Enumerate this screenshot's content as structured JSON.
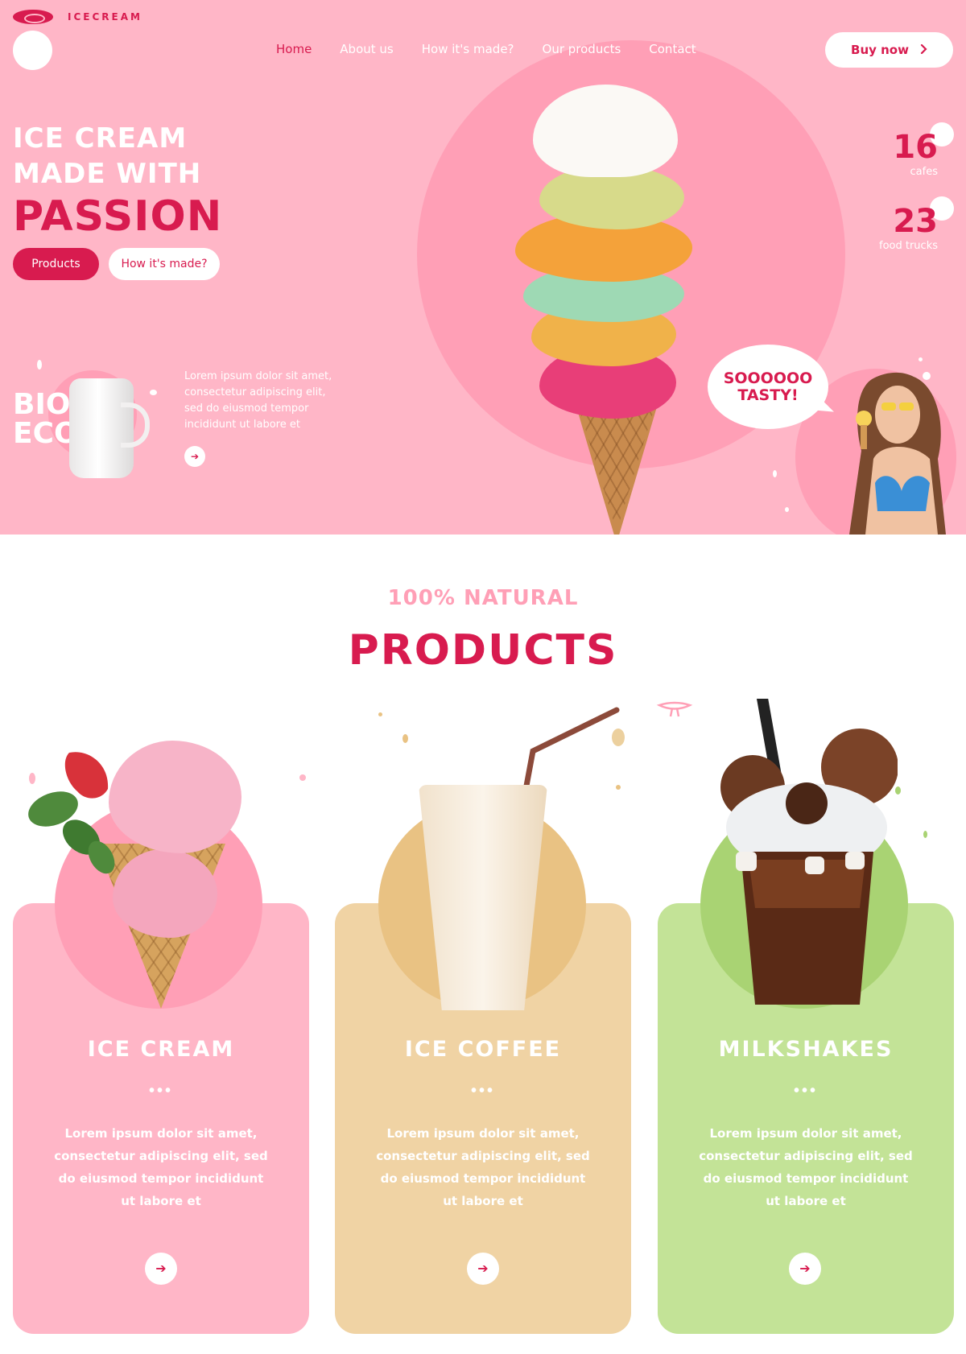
{
  "brand": {
    "name": "ICECREAM"
  },
  "nav": {
    "items": [
      {
        "label": "Home",
        "active": true
      },
      {
        "label": "About us",
        "active": false
      },
      {
        "label": "How it's made?",
        "active": false
      },
      {
        "label": "Our products",
        "active": false
      },
      {
        "label": "Contact",
        "active": false
      }
    ],
    "buy_label": "Buy now",
    "buy_icon": "chevron-right-icon"
  },
  "hero": {
    "title_line1": "ICE CREAM",
    "title_line2": "MADE WITH",
    "title_line3": "PASSION",
    "btn_primary": "Products",
    "btn_secondary": "How it's made?",
    "bio_text_line1": "BIO",
    "bio_text_line2": "ECO",
    "bio_description": "Lorem ipsum dolor sit amet, consectetur adipiscing elit, sed do eiusmod tempor incididunt ut labore et",
    "bubble_line1": "SOOOOOO",
    "bubble_line2": "TASTY!",
    "stats": [
      {
        "value": "16",
        "label": "cafes"
      },
      {
        "value": "23",
        "label": "food trucks"
      }
    ]
  },
  "products": {
    "eyebrow": "100% NATURAL",
    "title": "PRODUCTS",
    "items": [
      {
        "name": "ICE CREAM",
        "dots": "•••",
        "description": "Lorem ipsum dolor sit amet, consectetur adipiscing elit, sed do eiusmod tempor incididunt ut labore et",
        "arrow": "➔",
        "card_color": "#ffb6c7",
        "circle_color": "#ff9fb6"
      },
      {
        "name": "ICE COFFEE",
        "dots": "•••",
        "description": "Lorem ipsum dolor sit amet, consectetur adipiscing elit, sed do eiusmod tempor incididunt ut labore et",
        "arrow": "➔",
        "card_color": "#f0d3a4",
        "circle_color": "#e9c283"
      },
      {
        "name": "MILKSHAKES",
        "dots": "•••",
        "description": "Lorem ipsum dolor sit amet, consectetur adipiscing elit, sed do eiusmod tempor incididunt ut labore et",
        "arrow": "➔",
        "card_color": "#c3e397",
        "circle_color": "#a9d373"
      }
    ]
  },
  "colors": {
    "accent": "#d81b4f",
    "hero_bg": "#ffb6c7",
    "hero_circle": "#ff9fb6"
  }
}
